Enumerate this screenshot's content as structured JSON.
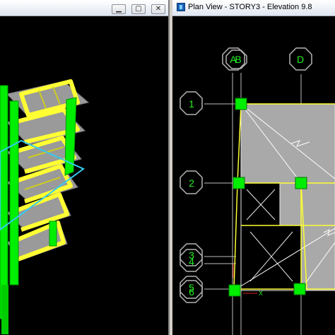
{
  "window_3d": {
    "buttons": {
      "minimize_icon": "minimize-icon",
      "maximize_icon": "maximize-icon",
      "close_icon": "close-icon"
    }
  },
  "plan_view": {
    "title": "Plan View - STORY3 - Elevation 9.8",
    "grid_bubbles": {
      "columns": [
        "A",
        "B",
        "D"
      ],
      "rows": [
        "1",
        "2",
        "3",
        "4",
        "5",
        "6"
      ]
    },
    "axis_label": "X"
  },
  "colors": {
    "background": "#000000",
    "columns": "#00ee00",
    "beams": "#ffff33",
    "slabs": "#a8a8a8",
    "selection": "#33ccee",
    "grid_bubble": "#b4b4b4",
    "grid_text": "#22ee22"
  }
}
